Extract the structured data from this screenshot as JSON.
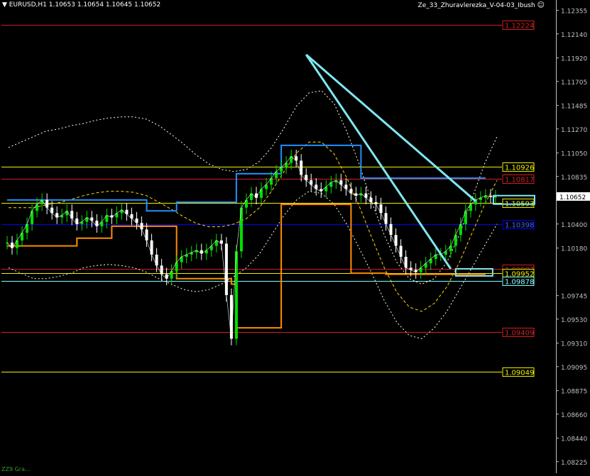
{
  "header": {
    "symbol_info": "EURUSD,H1  1.10653 1.10654 1.10645 1.10652",
    "indicator_name": "Ze_33_Zhuravlerezka_V-04-03_Ibush",
    "smiley_icon": "smiley-icon"
  },
  "footer": {
    "text": "ZZ9 Gra..."
  },
  "colors": {
    "background": "#000000",
    "axis": "#c0c0c0",
    "bull_candle": "#00e000",
    "bear_candle": "#ffffff",
    "level_red": "#d02020",
    "level_yellow": "#f0f000",
    "level_blue": "#0000ff",
    "level_cyan": "#80ffff",
    "zz_orange": "#ff8c00",
    "zz_blue": "#1e90ff",
    "arrow": "#7fe8f0",
    "band": "#ffffe0",
    "ma_yellow": "#ffd700"
  },
  "chart_data": {
    "type": "candlestick",
    "symbol": "EURUSD",
    "timeframe": "H1",
    "ohlc_last": {
      "open": 1.10653,
      "high": 1.10654,
      "low": 1.10645,
      "close": 1.10652
    },
    "ylim": [
      1.0812,
      1.1245
    ],
    "y_ticks": [
      "1.12355",
      "1.12140",
      "1.11920",
      "1.11705",
      "1.11485",
      "1.11270",
      "1.11050",
      "1.10835",
      "1.10400",
      "1.10180",
      "1.09745",
      "1.09530",
      "1.09310",
      "1.09095",
      "1.08875",
      "1.08660",
      "1.08440",
      "1.08225"
    ],
    "current_price": {
      "value": 1.10652,
      "label": "1.10652"
    },
    "levels": [
      {
        "label": "1.12224",
        "value": 1.12224,
        "color": "#d02020"
      },
      {
        "label": "1.10926",
        "value": 1.10926,
        "color": "#f0f000"
      },
      {
        "label": "1.10817",
        "value": 1.10817,
        "color": "#d02020"
      },
      {
        "label": "1.10593",
        "value": 1.10593,
        "color": "#f0f000"
      },
      {
        "label": "1.10398",
        "value": 1.10398,
        "color": "#0000ff"
      },
      {
        "label": "1.09987",
        "value": 1.09987,
        "color": "#d02020"
      },
      {
        "label": "1.09952",
        "value": 1.09952,
        "color": "#f0f000"
      },
      {
        "label": "1.09878",
        "value": 1.09878,
        "color": "#80ffff"
      },
      {
        "label": "1.09409",
        "value": 1.09409,
        "color": "#d02020"
      },
      {
        "label": "1.09049",
        "value": 1.09049,
        "color": "#f0f000"
      }
    ],
    "candles_close": [
      1.1023,
      1.1018,
      1.1025,
      1.1032,
      1.104,
      1.1052,
      1.1058,
      1.1062,
      1.1055,
      1.105,
      1.1046,
      1.1048,
      1.1052,
      1.1045,
      1.104,
      1.1042,
      1.1046,
      1.1043,
      1.1038,
      1.1042,
      1.1048,
      1.1046,
      1.105,
      1.1053,
      1.1049,
      1.1045,
      1.1041,
      1.1035,
      1.1025,
      1.1012,
      1.1002,
      1.0994,
      1.099,
      1.0997,
      1.1005,
      1.101,
      1.1012,
      1.1014,
      1.1016,
      1.1013,
      1.1016,
      1.102,
      1.1025,
      1.1022,
      1.0975,
      1.0935,
      1.1015,
      1.1055,
      1.1062,
      1.1068,
      1.1064,
      1.1072,
      1.1076,
      1.1082,
      1.1088,
      1.1092,
      1.1096,
      1.1102,
      1.1098,
      1.1085,
      1.108,
      1.1076,
      1.1072,
      1.107,
      1.1074,
      1.1078,
      1.108,
      1.1076,
      1.1072,
      1.1068,
      1.1066,
      1.1068,
      1.1064,
      1.106,
      1.1058,
      1.105,
      1.104,
      1.103,
      1.102,
      1.101,
      1.1,
      1.0998,
      1.0996,
      1.1,
      1.1004,
      1.1008,
      1.1012,
      1.1012,
      1.1015,
      1.102,
      1.103,
      1.104,
      1.1052,
      1.1058,
      1.1062,
      1.1064,
      1.1066,
      1.1065,
      1.1065
    ],
    "band_upper": [
      1.111,
      1.1115,
      1.112,
      1.1125,
      1.1127,
      1.113,
      1.1132,
      1.1135,
      1.1137,
      1.1138,
      1.1138,
      1.1136,
      1.113,
      1.1122,
      1.1113,
      1.1103,
      1.1095,
      1.109,
      1.1088,
      1.109,
      1.1097,
      1.111,
      1.1128,
      1.1148,
      1.116,
      1.1162,
      1.115,
      1.1125,
      1.1095,
      1.106,
      1.103,
      1.1005,
      1.099,
      1.0985,
      1.099,
      1.1005,
      1.103,
      1.1063,
      1.1095,
      1.112
    ],
    "band_lower": [
      1.1,
      1.0995,
      1.099,
      1.099,
      1.0992,
      1.0995,
      1.1,
      1.1002,
      1.1003,
      1.1002,
      1.1,
      1.0996,
      1.099,
      1.0985,
      1.098,
      1.0978,
      1.098,
      1.0985,
      1.0992,
      1.1,
      1.1012,
      1.103,
      1.1048,
      1.1062,
      1.107,
      1.1068,
      1.1058,
      1.104,
      1.1018,
      1.0995,
      1.097,
      1.095,
      1.0938,
      1.0935,
      1.0945,
      1.096,
      1.098,
      1.1,
      1.102,
      1.104
    ],
    "arrow_start": [
      1.1195,
      1.1195
    ],
    "title": "",
    "xlabel": "",
    "ylabel": ""
  }
}
